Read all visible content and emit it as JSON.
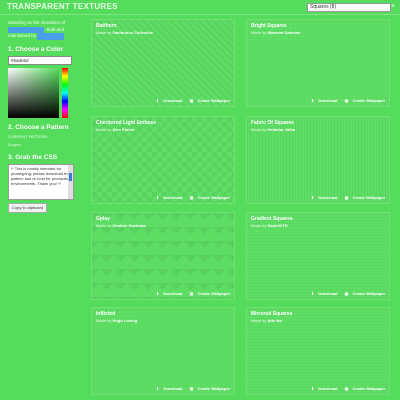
{
  "header": {
    "title": "TRANSPARENT TEXTURES",
    "search_value": "Squares (8)"
  },
  "sidebar": {
    "intro_text": "Standing on the shoulders of",
    "intro_built": ". Built and",
    "intro_maintained": "maintained by",
    "step1": "1. Choose a Color",
    "color_value": "#5ade5d",
    "step2": "2. Choose a Pattern",
    "current_pattern_label": "CURRENT PATTERN:",
    "current_pattern_value": "Grayzz.",
    "step3": "3. Grab the CSS",
    "css_text": "/* This is mostly intended for prototyping; please download the pattern and re-host for production environments. Thank you! */",
    "copy_label": "Copy to clipboard"
  },
  "card_labels": {
    "made_by": "Made by",
    "download": "Download",
    "create_wallpaper": "Create Wallpaper"
  },
  "cards": [
    {
      "title": "Batthern",
      "author": "Factorious Collective"
    },
    {
      "title": "Bright Squares",
      "author": "Waseem Dahman"
    },
    {
      "title": "Checkered Light Emboss",
      "author": "Alex Parker"
    },
    {
      "title": "Fabric Of Squares",
      "author": "Heliodor Jalba"
    },
    {
      "title": "Gplay",
      "author": "Dimitrie Hoekstra"
    },
    {
      "title": "Gradient Squares",
      "author": "DanielKTR"
    },
    {
      "title": "Inflicted",
      "author": "Hugo Loning"
    },
    {
      "title": "Mirrored Squares",
      "author": "Atle Mo"
    }
  ],
  "colors": {
    "background": "#56dc5c",
    "link_highlight": "#4aa0e8"
  }
}
